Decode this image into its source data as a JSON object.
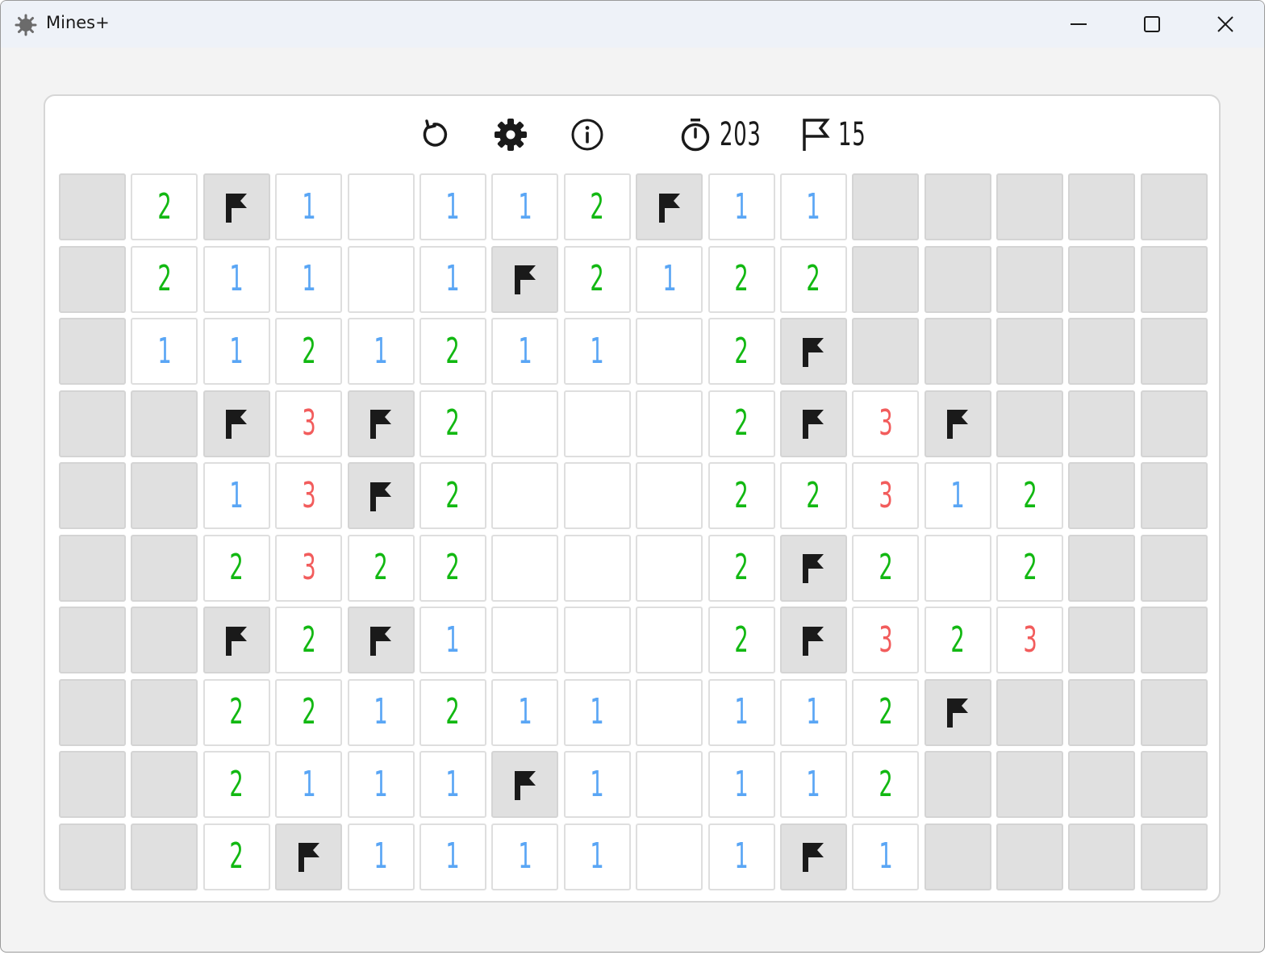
{
  "window": {
    "title": "Mines+",
    "app_icon": "mine-icon",
    "controls": [
      "minimize-icon",
      "maximize-icon",
      "close-icon"
    ]
  },
  "toolbar": {
    "buttons": [
      "restart-icon",
      "settings-icon",
      "info-icon"
    ],
    "timer": {
      "icon": "stopwatch-icon",
      "value": "203"
    },
    "flags": {
      "icon": "flag-icon",
      "value": "15"
    }
  },
  "colors": {
    "one": "#5aa6f5",
    "two": "#12b812",
    "three": "#f25c5c",
    "hidden_cell": "#e0e0e0",
    "open_cell": "#ffffff",
    "flag": "#1a1a1a"
  },
  "board": {
    "cols": 16,
    "rows": 10,
    "legend": {
      "H": "hidden",
      "F": "flagged",
      "0": "open-empty",
      "1-8": "open-number"
    },
    "grid": [
      [
        "H",
        "2",
        "F",
        "1",
        "0",
        "1",
        "1",
        "2",
        "F",
        "1",
        "1",
        "H",
        "H",
        "H",
        "H",
        "H"
      ],
      [
        "H",
        "2",
        "1",
        "1",
        "0",
        "1",
        "F",
        "2",
        "1",
        "2",
        "2",
        "H",
        "H",
        "H",
        "H",
        "H"
      ],
      [
        "H",
        "1",
        "1",
        "2",
        "1",
        "2",
        "1",
        "1",
        "0",
        "2",
        "F",
        "H",
        "H",
        "H",
        "H",
        "H"
      ],
      [
        "H",
        "H",
        "F",
        "3",
        "F",
        "2",
        "0",
        "0",
        "0",
        "2",
        "F",
        "3",
        "F",
        "H",
        "H",
        "H"
      ],
      [
        "H",
        "H",
        "1",
        "3",
        "F",
        "2",
        "0",
        "0",
        "0",
        "2",
        "2",
        "3",
        "1",
        "2",
        "H",
        "H"
      ],
      [
        "H",
        "H",
        "2",
        "3",
        "2",
        "2",
        "0",
        "0",
        "0",
        "2",
        "F",
        "2",
        "0",
        "2",
        "H",
        "H"
      ],
      [
        "H",
        "H",
        "F",
        "2",
        "F",
        "1",
        "0",
        "0",
        "0",
        "2",
        "F",
        "3",
        "2",
        "3",
        "H",
        "H"
      ],
      [
        "H",
        "H",
        "2",
        "2",
        "1",
        "2",
        "1",
        "1",
        "0",
        "1",
        "1",
        "2",
        "F",
        "H",
        "H",
        "H"
      ],
      [
        "H",
        "H",
        "2",
        "1",
        "1",
        "1",
        "F",
        "1",
        "0",
        "1",
        "1",
        "2",
        "H",
        "H",
        "H",
        "H"
      ],
      [
        "H",
        "H",
        "2",
        "F",
        "1",
        "1",
        "1",
        "1",
        "0",
        "1",
        "F",
        "1",
        "H",
        "H",
        "H",
        "H"
      ]
    ]
  }
}
